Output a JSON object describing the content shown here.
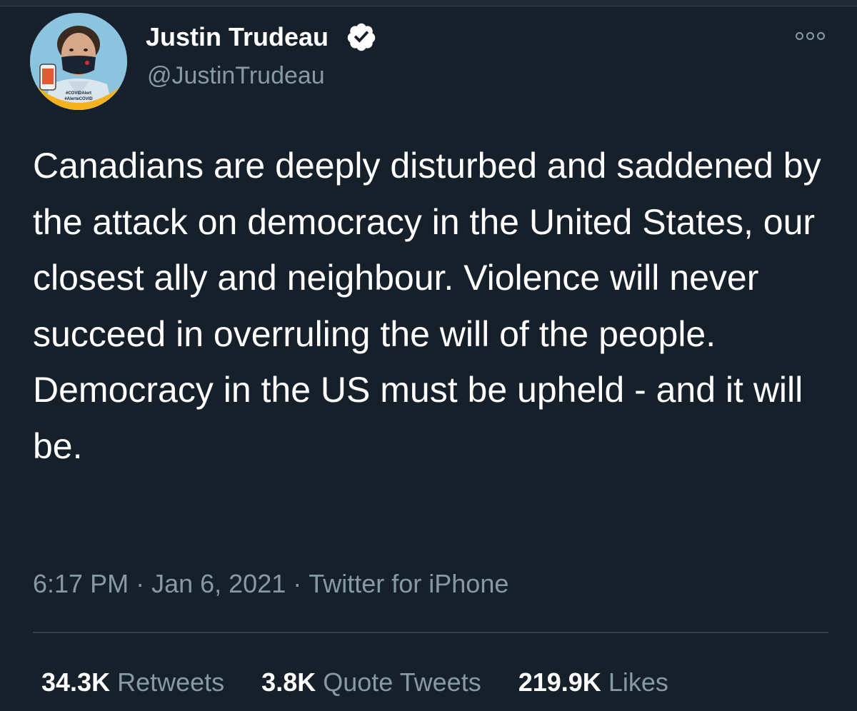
{
  "author": {
    "name": "Justin Trudeau",
    "handle": "@JustinTrudeau",
    "verified": true,
    "avatar_badge": [
      "#COVIDAlert",
      "#AlerteCOVID"
    ]
  },
  "tweet": {
    "text": "Canadians are deeply disturbed and saddened by the attack on democracy in the United States, our closest ally and neighbour. Violence will never succeed in overruling the will of the people. Democracy in the US must be upheld - and it will be."
  },
  "meta": {
    "time": "6:17 PM",
    "date": "Jan 6, 2021",
    "separator": "·",
    "source": "Twitter for iPhone"
  },
  "stats": {
    "retweets": {
      "count": "34.3K",
      "label": "Retweets"
    },
    "quotes": {
      "count": "3.8K",
      "label": "Quote Tweets"
    },
    "likes": {
      "count": "219.9K",
      "label": "Likes"
    }
  },
  "icons": {
    "verified": "verified-badge-icon",
    "more": "more-options-icon"
  },
  "colors": {
    "background": "#15202b",
    "text_primary": "#ffffff",
    "text_secondary": "#8899a6",
    "divider": "#38444d",
    "badge_yellow": "#f5b21c"
  }
}
